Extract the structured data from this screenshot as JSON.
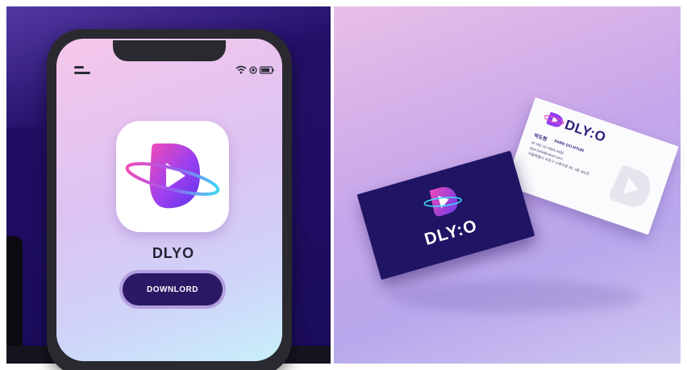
{
  "app": {
    "name": "DLYO",
    "download_label": "DOWNLORD",
    "icon_name": "play-planet-logo-icon"
  },
  "status_bar": {
    "icons": [
      "menu-icon",
      "wifi-icon",
      "alarm-icon",
      "battery-icon"
    ]
  },
  "business_card": {
    "brand": "DLY:O",
    "front_brand": "DLY:O",
    "name_korean": "박도현",
    "name_english": "PARK DO HYUN",
    "phone": "M  +82 10-7004-4483",
    "email": "dlyo.baki@naver.com",
    "address": "서울특별시 서초구 나루터로 95, 4층 401호"
  },
  "colors": {
    "brand_navy": "#1f1564",
    "brand_pink": "#f04bb8",
    "brand_purple": "#7a3cf0",
    "brand_cyan": "#3fd8f5"
  }
}
